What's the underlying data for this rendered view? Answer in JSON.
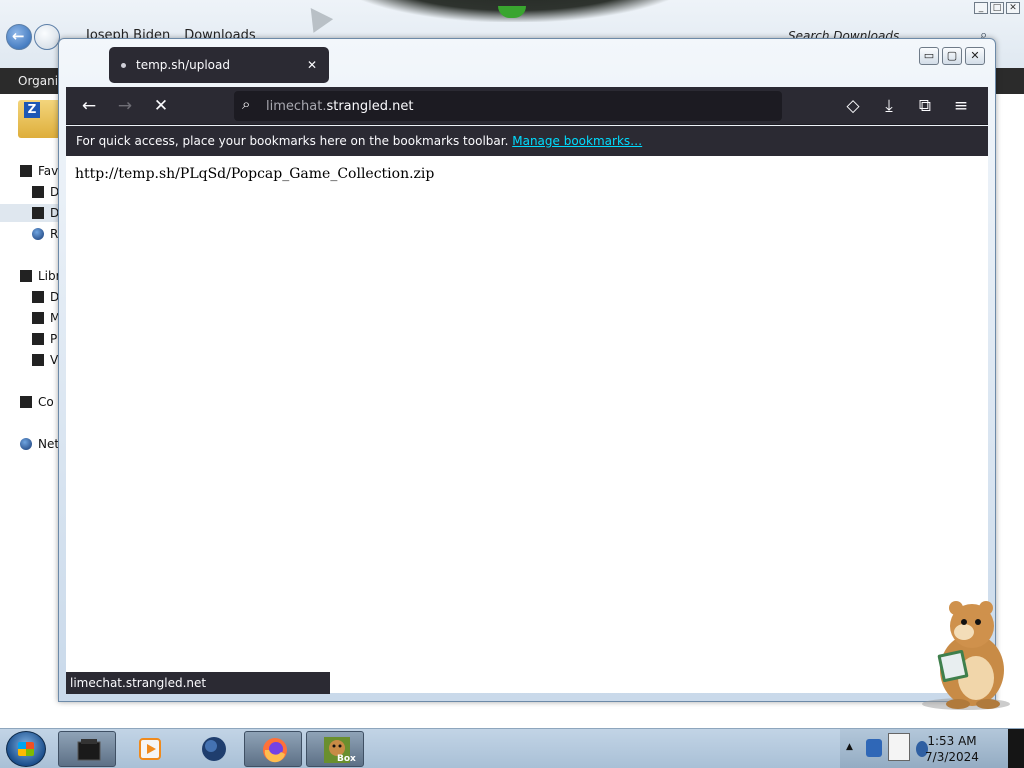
{
  "explorer": {
    "breadcrumb": [
      "Joseph Biden",
      "Downloads"
    ],
    "search_placeholder": "Search Downloads",
    "command_bar_label": "Organize",
    "window_buttons": [
      "_",
      "□",
      "✕"
    ],
    "sidebar": {
      "favorites_label": "Fav",
      "items": [
        {
          "label": "D",
          "icon": "desktop-icon"
        },
        {
          "label": "D",
          "icon": "downloads-icon",
          "selected": true
        },
        {
          "label": "R",
          "icon": "recent-places-icon"
        }
      ],
      "libraries_label": "Libr",
      "library_items": [
        {
          "label": "D",
          "icon": "documents-icon"
        },
        {
          "label": "M",
          "icon": "music-icon"
        },
        {
          "label": "P",
          "icon": "pictures-icon"
        },
        {
          "label": "V",
          "icon": "videos-icon"
        }
      ],
      "computer_label": "Co",
      "network_label": "Net"
    }
  },
  "firefox": {
    "window_buttons": [
      "▭",
      "▢",
      "✕"
    ],
    "tab": {
      "title": "temp.sh/upload",
      "close_glyph": "✕"
    },
    "toolbar": {
      "back_glyph": "←",
      "forward_glyph": "→",
      "stop_glyph": "✕",
      "search_glyph": "⌕",
      "url_prefix": "limechat.",
      "url_domain": "strangled.net",
      "pocket_glyph": "◇",
      "downloads_glyph": "⤓",
      "extensions_glyph": "⧉",
      "menu_glyph": "≡"
    },
    "bookmarks_bar": {
      "message": "For quick access, place your bookmarks here on the bookmarks toolbar.",
      "link": "Manage bookmarks…"
    },
    "content": {
      "text": "http://temp.sh/PLqSd/Popcap_Game_Collection.zip"
    },
    "status": "limechat.strangled.net"
  },
  "taskbar": {
    "clock_time": "1:53 AM",
    "clock_date": "7/3/2024",
    "tray_arrow": "▲",
    "apps": [
      {
        "name": "task-terminal-icon"
      },
      {
        "name": "task-media-player-icon"
      },
      {
        "name": "task-globe-icon"
      },
      {
        "name": "task-firefox-icon"
      },
      {
        "name": "task-box-game-icon",
        "label": "Box"
      }
    ]
  }
}
